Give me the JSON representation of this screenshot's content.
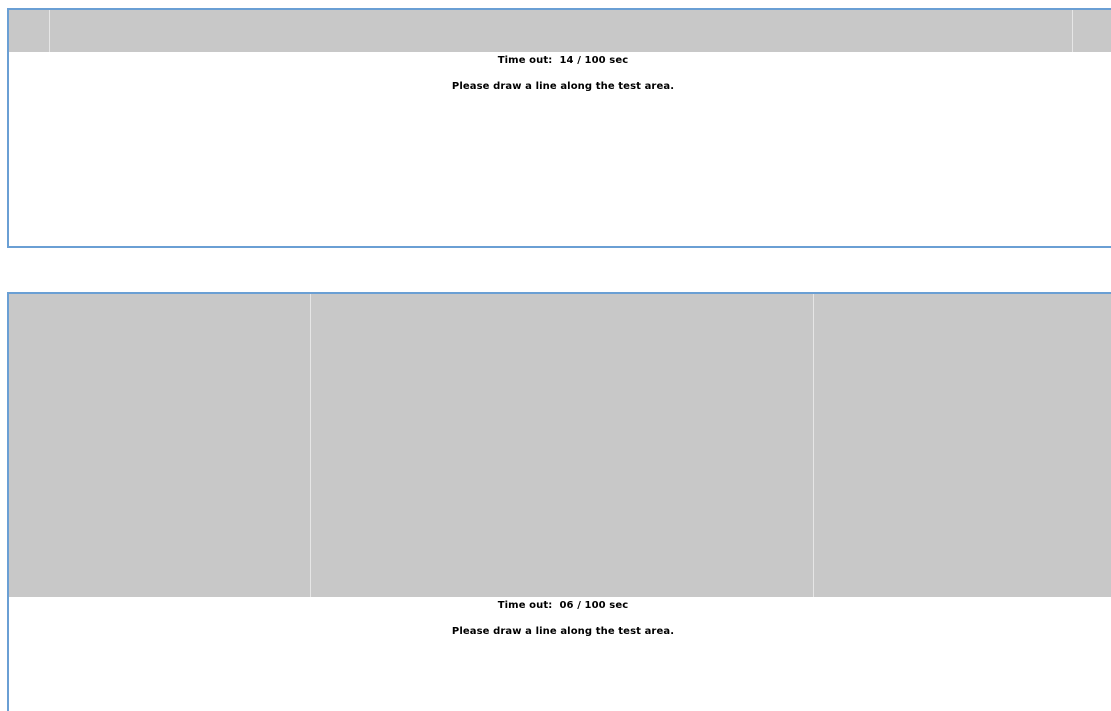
{
  "colors": {
    "panel_border": "#6a9fd4",
    "test_area": "#c8c8c8",
    "zone_divider": "#e6e6e6",
    "text": "#000000"
  },
  "panels": [
    {
      "timeout_text": "Time out:  14 / 100 sec",
      "instruction": "Please draw a line along the test area."
    },
    {
      "timeout_text": "Time out:  06 / 100 sec",
      "instruction": "Please draw a line along the test area."
    }
  ]
}
